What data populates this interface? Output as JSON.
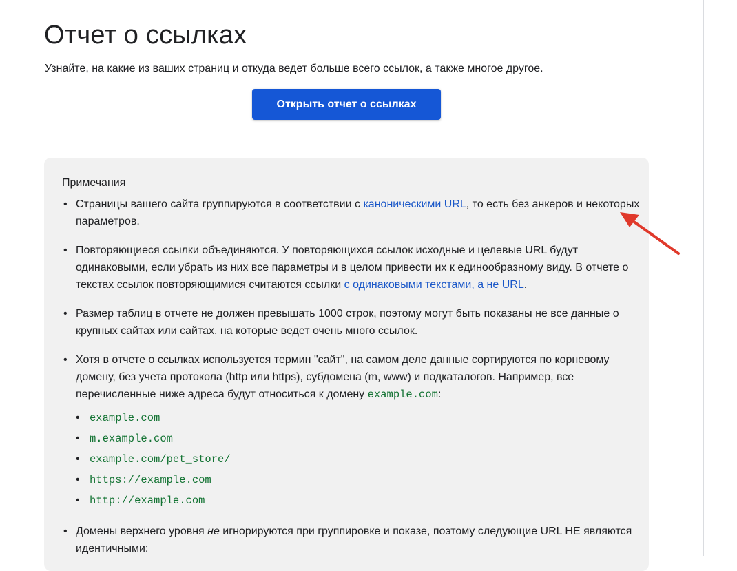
{
  "header": {
    "title": "Отчет о ссылках",
    "subtitle": "Узнайте, на какие из ваших страниц и откуда ведет больше всего ссылок, а также многое другое."
  },
  "cta": {
    "label": "Открыть отчет о ссылках"
  },
  "notes": {
    "title": "Примечания",
    "item1": {
      "text_before": "Страницы вашего сайта группируются в соответствии с ",
      "link": "каноническими URL",
      "text_after": ", то есть без анкеров и некоторых параметров."
    },
    "item2": {
      "text_before": "Повторяющиеся ссылки объединяются. У повторяющихся ссылок исходные и целевые URL будут одинаковыми, если убрать из них все параметры и в целом привести их к единообразному виду. В отчете о текстах ссылок повторяющимися считаются ссылки ",
      "link": "с одинаковыми текстами, а не URL",
      "text_after": "."
    },
    "item3": {
      "text": "Размер таблиц в отчете не должен превышать 1000 строк, поэтому могут быть показаны не все данные о крупных сайтах или сайтах, на которые ведет очень много ссылок."
    },
    "item4": {
      "text_before": "Хотя в отчете о ссылках используется термин \"сайт\", на самом деле данные сортируются по корневому домену, без учета протокола (http или https), субдомена (m, www) и подкаталогов. Например, все перечисленные ниже адреса будут относиться к домену ",
      "code": "example.com",
      "text_after": ":",
      "examples": [
        "example.com",
        "m.example.com",
        "example.com/pet_store/",
        "https://example.com",
        "http://example.com"
      ]
    },
    "item5": {
      "text_before": "Домены верхнего уровня ",
      "emphasis": "не",
      "text_after": " игнорируются при группировке и показе, поэтому следующие URL НЕ являются идентичными:"
    }
  },
  "colors": {
    "button": "#1557d6",
    "link": "#1a57c8",
    "code": "#137333",
    "notes_bg": "#f1f1f1",
    "arrow": "#e0392b"
  },
  "icons": {
    "annotation": "red-arrow-icon",
    "bullet": "bullet-dot"
  }
}
